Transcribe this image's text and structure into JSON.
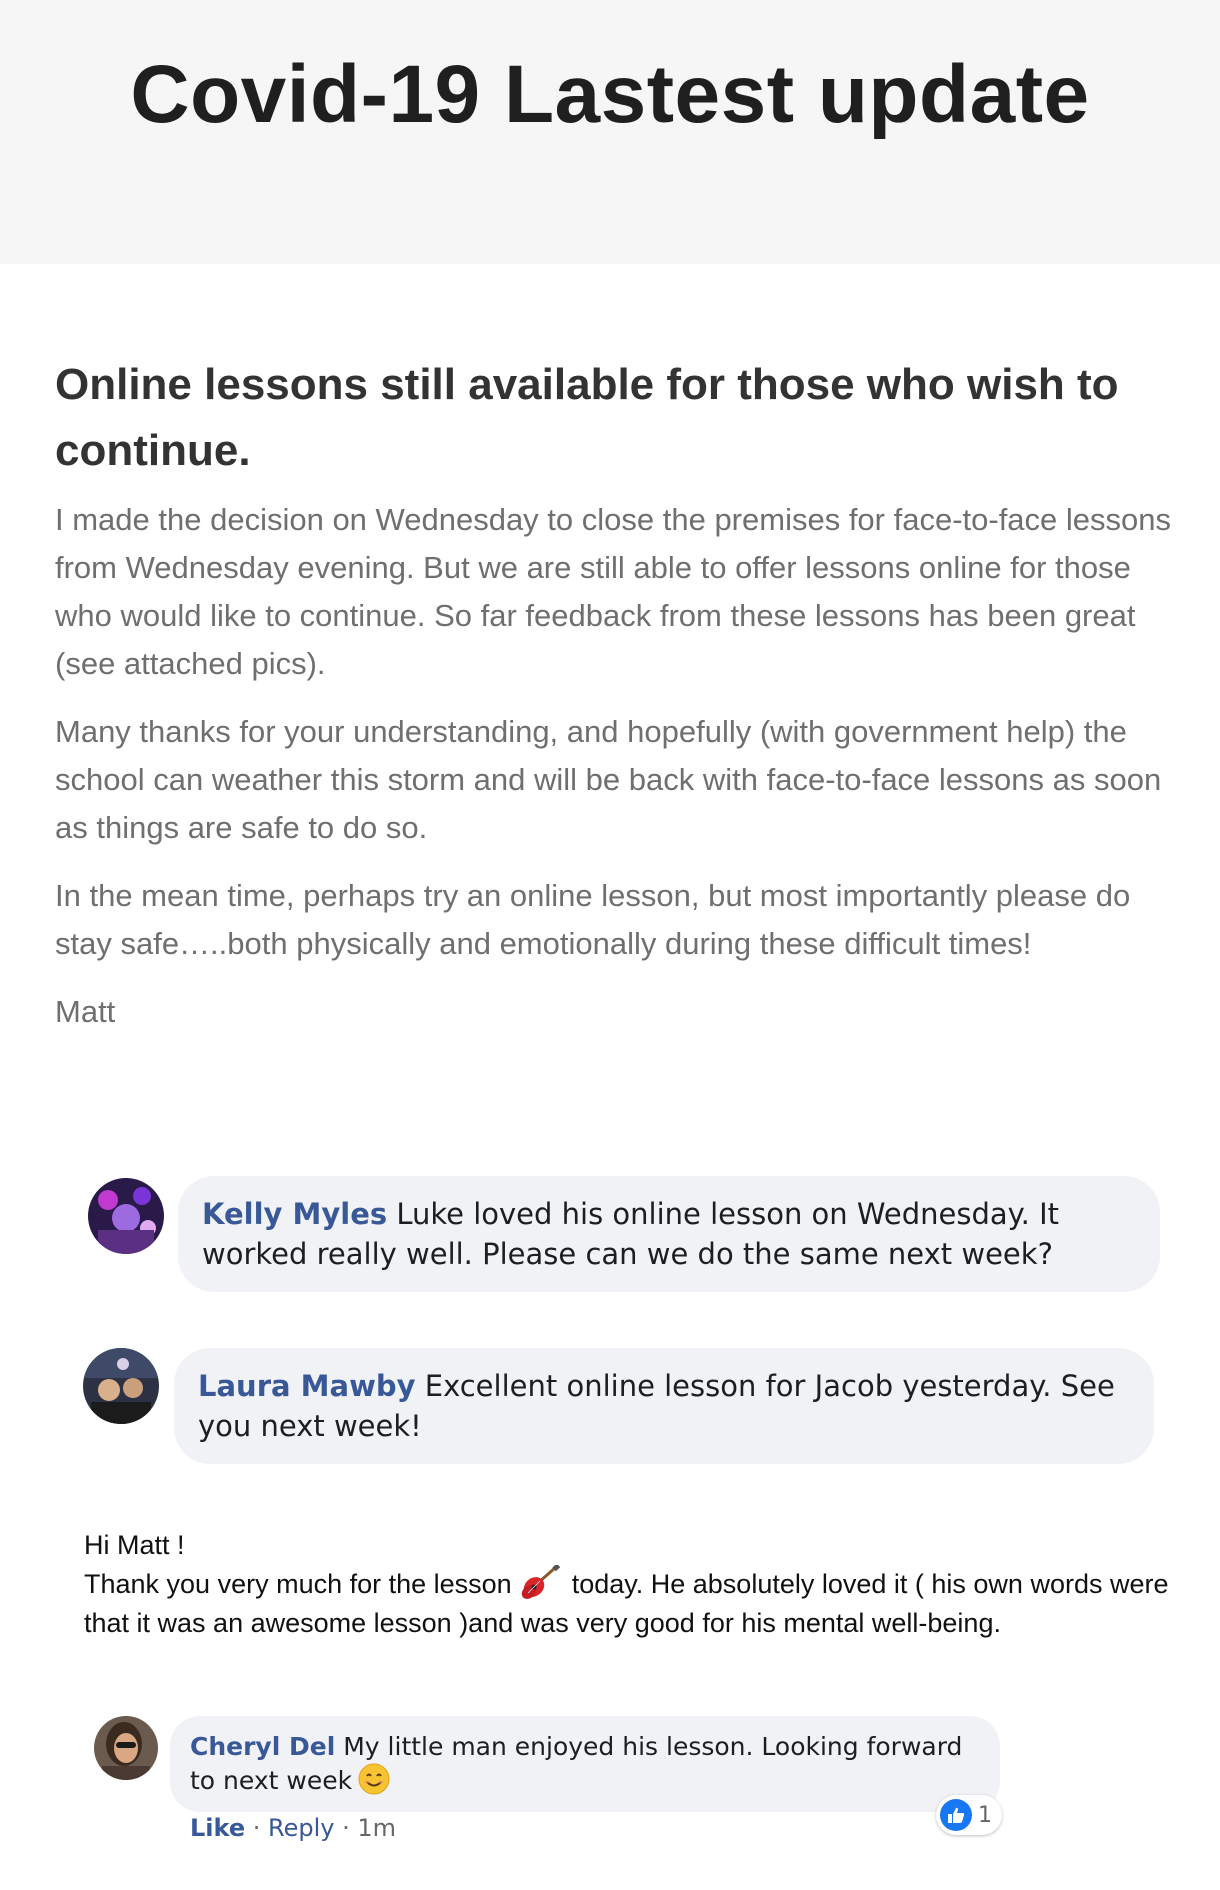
{
  "header": {
    "title": "Covid-19 Lastest update"
  },
  "article": {
    "heading": "Online lessons still available for those who wish to continue.",
    "paragraphs": [
      "I made the decision on Wednesday to close the premises for face-to-face lessons from Wednesday evening. But we are still able to offer lessons online for those who would like to continue. So far feedback from these lessons has been great (see attached pics).",
      "Many thanks for your understanding, and hopefully (with government help) the school can weather this storm and will be back with face-to-face lessons as soon as things are safe to do so.",
      "In the mean time, perhaps try an online lesson, but most importantly please do stay safe…..both physically and emotionally during these difficult times!",
      "Matt"
    ]
  },
  "comments": [
    {
      "name": "Kelly Myles",
      "text": "Luke loved his online lesson on Wednesday. It worked really well. Please can we do the same next week?"
    },
    {
      "name": "Laura Mawby",
      "text": "Excellent online lesson for Jacob yesterday. See you next week!"
    },
    {
      "name": "Cheryl Del",
      "text": "My little man enjoyed his lesson. Looking forward to next week"
    }
  ],
  "message": {
    "greeting": "Hi Matt !",
    "line_before_icon": "Thank you very much for the lesson",
    "line_after_icon": "today. He absolutely loved it ( his own words were that it was an awesome lesson )and was very good for his mental well-being."
  },
  "comment_actions": {
    "like_label": "Like",
    "separator": " · ",
    "reply_label": "Reply",
    "time": "1m",
    "reaction_count": "1"
  },
  "colors": {
    "name_link": "#385898",
    "bubble_bg": "#f0f2f5",
    "like_blue": "#1877f2",
    "header_bg": "#f6f6f6"
  },
  "icons": {
    "guitar": "guitar-icon",
    "smile": "smiling-face-icon",
    "like": "thumbs-up-icon"
  }
}
